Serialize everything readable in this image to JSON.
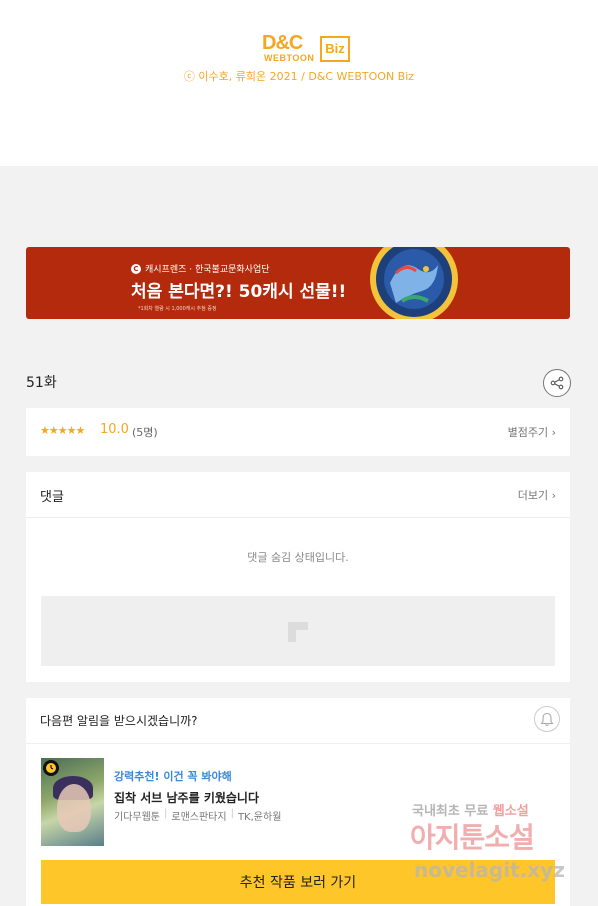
{
  "header": {
    "logo_dc": "D&C",
    "logo_webtoon": "WEBTOON",
    "logo_biz": "Biz",
    "copyright": "ⓒ 이수호, 류희온 2021 / D&C WEBTOON Biz"
  },
  "banner": {
    "brand_icon": "C",
    "line1": "캐시프렌즈 · 한국불교문화사업단",
    "line2": "처음 본다면?! 50캐시 선물!!",
    "line3": "*1회차 열람 시 1,000캐시 추첨 증정"
  },
  "episode": {
    "title": "51화",
    "share_icon": "share-icon"
  },
  "rating": {
    "stars": "★★★★★",
    "score": "10.0",
    "count": "(5명)",
    "rate_link": "별점주기 ›"
  },
  "comments": {
    "title": "댓글",
    "more_link": "더보기 ›",
    "hidden_notice": "댓글 숨김 상태입니다."
  },
  "next_alert": {
    "question": "다음편 알림을 받으시겠습니까?",
    "bell_icon": "bell-icon"
  },
  "recommendation": {
    "tag": "강력추천! 이건 꼭 봐야해",
    "title": "집착 서브 남주를 키웠습니다",
    "meta": [
      "기다무웹툰",
      "로맨스판타지",
      "TK,윤하월"
    ],
    "button": "추천 작품 보러 가기"
  },
  "watermark": {
    "line1_a": "국내최초 무료 ",
    "line1_b": "웹소설",
    "line2": "아지툰소설",
    "line3": "novelagit.xyz"
  },
  "colors": {
    "accent_orange": "#f5a623",
    "banner_red": "#b32a0c",
    "button_yellow": "#ffc62a",
    "link_blue": "#3a89d8"
  }
}
